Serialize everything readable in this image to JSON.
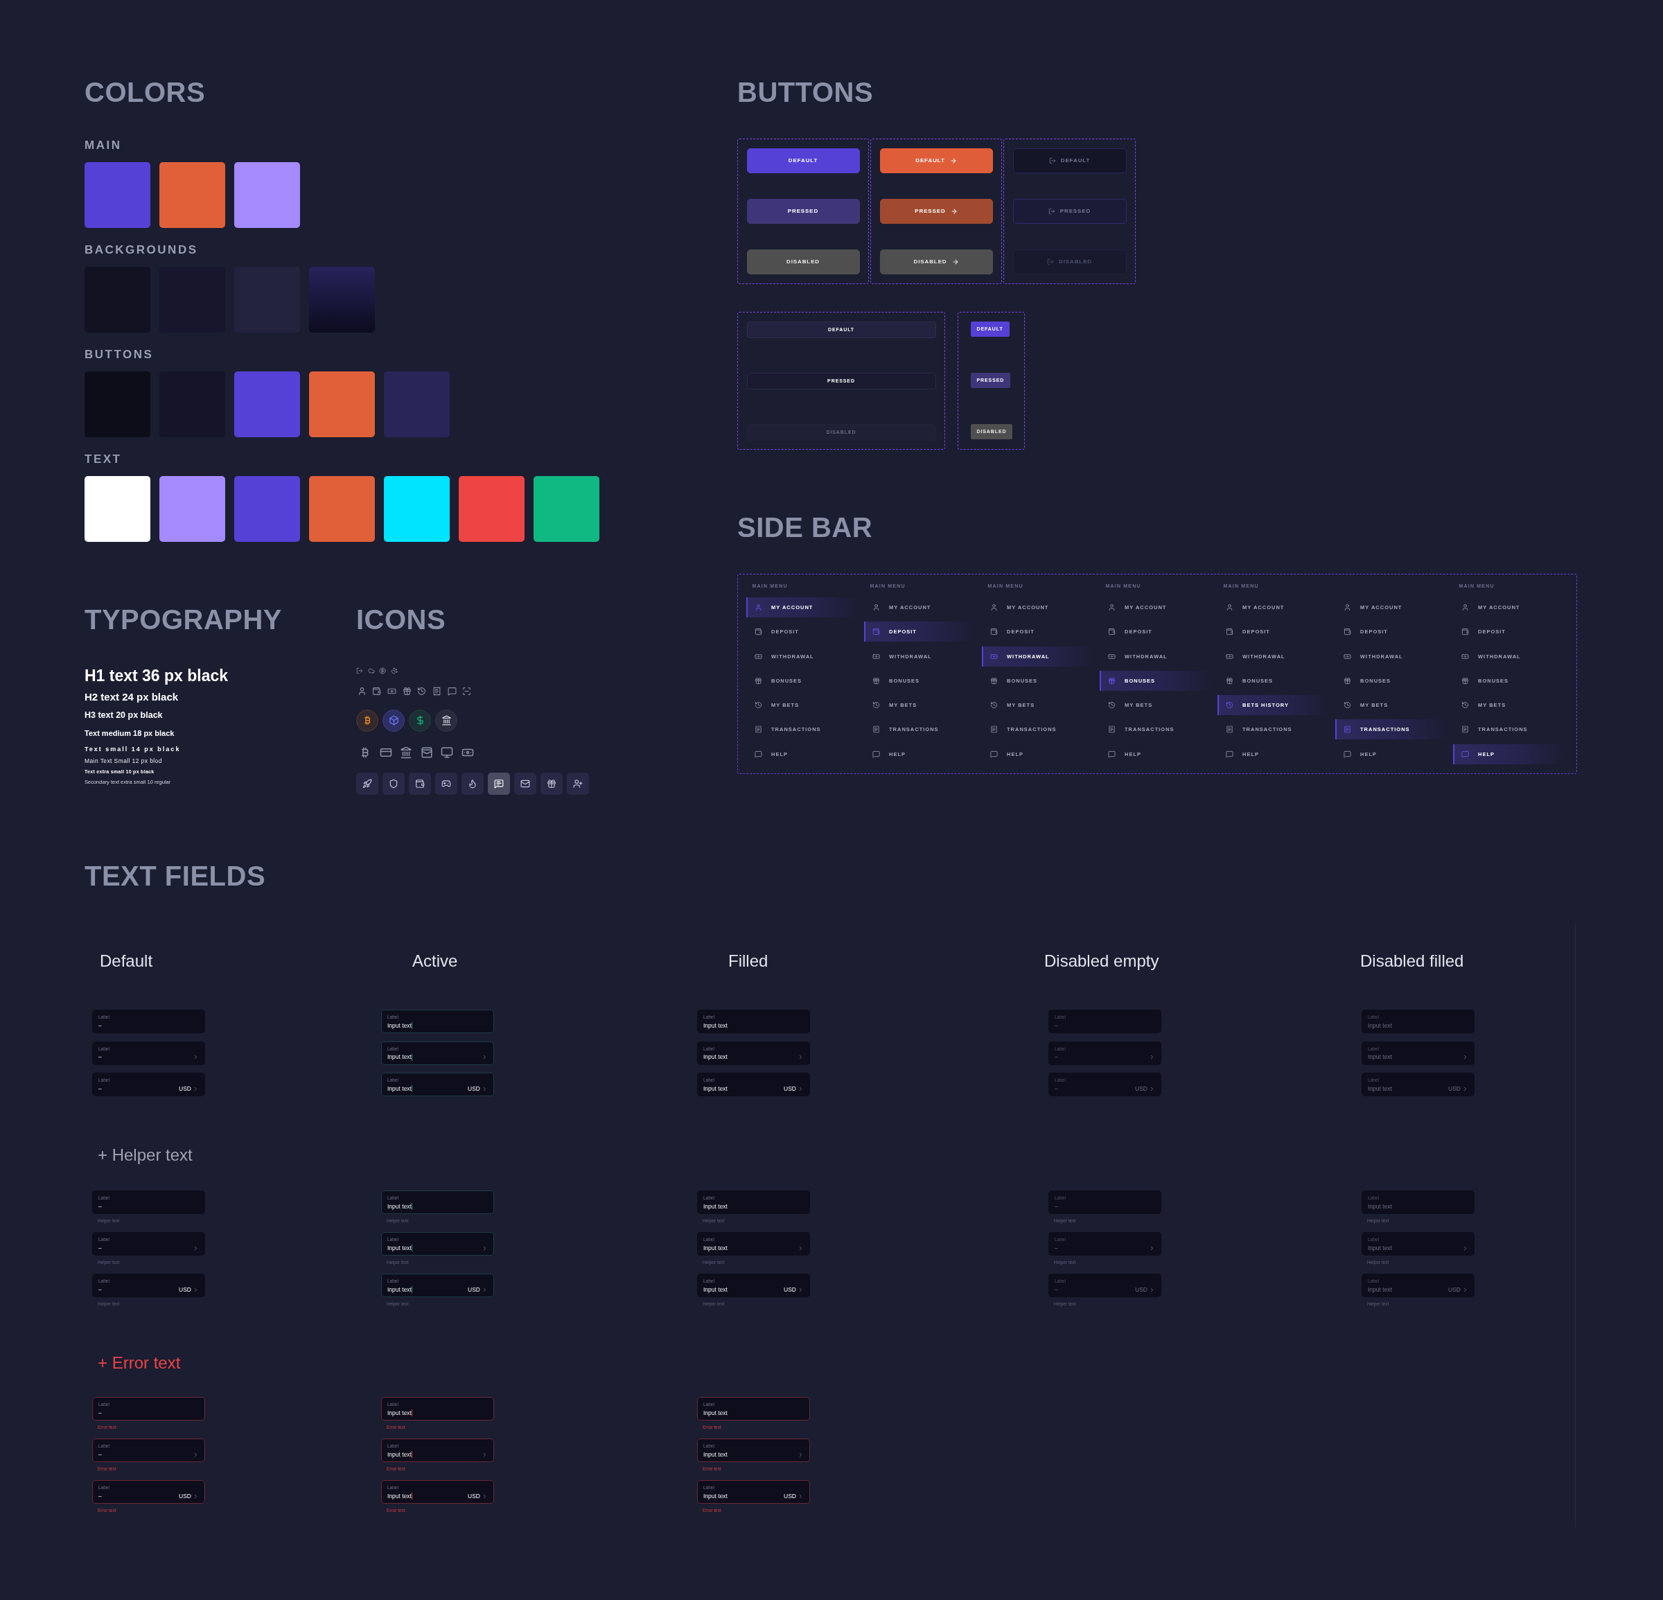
{
  "colors": {
    "title": "COLORS",
    "groups": [
      {
        "title": "MAIN",
        "swatches": [
          {
            "color": "#5641d6"
          },
          {
            "color": "#e0603a"
          },
          {
            "color": "#a48afc"
          }
        ]
      },
      {
        "title": "BACKGROUNDS",
        "swatches": [
          {
            "kind": "solid",
            "color": "#121222"
          },
          {
            "kind": "solid",
            "color": "#17162d"
          },
          {
            "kind": "solid",
            "color": "#23223f"
          },
          {
            "kind": "gradient",
            "color": "#26245a"
          }
        ]
      },
      {
        "title": "BUTTONS",
        "swatches": [
          {
            "color": "#0d0d19"
          },
          {
            "color": "#151429"
          },
          {
            "color": "#5641d6"
          },
          {
            "color": "#e0603a"
          },
          {
            "color": "#282659"
          }
        ]
      },
      {
        "title": "TEXT",
        "swatches": [
          {
            "color": "#ffffff"
          },
          {
            "color": "#a48afc"
          },
          {
            "color": "#5641d6"
          },
          {
            "color": "#e0603a"
          },
          {
            "color": "#00e5ff"
          },
          {
            "color": "#ef4444"
          },
          {
            "color": "#10b981"
          }
        ]
      }
    ]
  },
  "typography": {
    "title": "TYPOGRAPHY",
    "samples": [
      {
        "kind": "h1",
        "text": "H1 text 36 px black"
      },
      {
        "kind": "h2",
        "text": "H2 text 24 px black"
      },
      {
        "kind": "h3",
        "text": "H3 text 20 px black"
      },
      {
        "kind": "medium",
        "text": "Text medium 18 px black"
      },
      {
        "kind": "small",
        "text": "Text small 14 px black"
      },
      {
        "kind": "main_small",
        "text": "Main Text Small 12 px blod"
      },
      {
        "kind": "extra_small",
        "text": "Text extra small 10 px black"
      },
      {
        "kind": "secondary",
        "text": "Secondary text extra small 10 regular"
      }
    ]
  },
  "icons": {
    "title": "ICONS",
    "tiles": [
      {
        "selected": false
      },
      {
        "selected": false
      },
      {
        "selected": false
      },
      {
        "selected": false
      },
      {
        "selected": false
      },
      {
        "selected": true
      },
      {
        "selected": false
      },
      {
        "selected": false
      },
      {
        "selected": false
      }
    ]
  },
  "buttons": {
    "title": "BUTTONS",
    "rows": [
      {
        "groups": [
          {
            "kind": "primary",
            "buttons": [
              {
                "label": "DEFAULT",
                "pressed": false,
                "disabled": false
              },
              {
                "label": "PRESSED",
                "pressed": true,
                "disabled": false
              },
              {
                "label": "DISABLED",
                "pressed": false,
                "disabled": true
              }
            ]
          },
          {
            "kind": "accent",
            "buttons": [
              {
                "label": "DEFAULT",
                "pressed": false,
                "disabled": false
              },
              {
                "label": "PRESSED",
                "pressed": true,
                "disabled": false
              },
              {
                "label": "DISABLED",
                "pressed": false,
                "disabled": true
              }
            ]
          },
          {
            "kind": "outline",
            "buttons": [
              {
                "label": "DEFAULT",
                "pressed": false,
                "disabled": false
              },
              {
                "label": "PRESSED",
                "pressed": true,
                "disabled": false
              },
              {
                "label": "DISABLED",
                "pressed": false,
                "disabled": true
              }
            ]
          }
        ]
      },
      {
        "groups": [
          {
            "kind": "secondary",
            "buttons": [
              {
                "label": "DEFAULT",
                "pressed": false,
                "disabled": false
              },
              {
                "label": "PRESSED",
                "pressed": true,
                "disabled": false
              },
              {
                "label": "DISABLED",
                "pressed": false,
                "disabled": true
              }
            ]
          },
          {
            "kind": "small",
            "buttons": [
              {
                "label": "DEFAULT",
                "pressed": false,
                "disabled": false
              },
              {
                "label": "PRESSED",
                "pressed": true,
                "disabled": false
              },
              {
                "label": "DISABLED",
                "pressed": false,
                "disabled": true
              }
            ]
          }
        ]
      }
    ]
  },
  "sidebar": {
    "title": "SIDE BAR",
    "panels": [
      {
        "heading": "MAIN MENU",
        "items": [
          {
            "label": "MY ACCOUNT",
            "selected": true
          },
          {
            "label": "DEPOSIT",
            "selected": false
          },
          {
            "label": "WITHDRAWAL",
            "selected": false
          },
          {
            "label": "BONUSES",
            "selected": false
          },
          {
            "label": "MY BETS",
            "selected": false
          },
          {
            "label": "TRANSACTIONS",
            "selected": false
          },
          {
            "label": "HELP",
            "selected": false
          }
        ]
      },
      {
        "heading": "MAIN MENU",
        "items": [
          {
            "label": "MY ACCOUNT",
            "selected": false
          },
          {
            "label": "DEPOSIT",
            "selected": true
          },
          {
            "label": "WITHDRAWAL",
            "selected": false
          },
          {
            "label": "BONUSES",
            "selected": false
          },
          {
            "label": "MY BETS",
            "selected": false
          },
          {
            "label": "TRANSACTIONS",
            "selected": false
          },
          {
            "label": "HELP",
            "selected": false
          }
        ]
      },
      {
        "heading": "MAIN MENU",
        "items": [
          {
            "label": "MY ACCOUNT",
            "selected": false
          },
          {
            "label": "DEPOSIT",
            "selected": false
          },
          {
            "label": "WITHDRAWAL",
            "selected": true
          },
          {
            "label": "BONUSES",
            "selected": false
          },
          {
            "label": "MY BETS",
            "selected": false
          },
          {
            "label": "TRANSACTIONS",
            "selected": false
          },
          {
            "label": "HELP",
            "selected": false
          }
        ]
      },
      {
        "heading": "MAIN MENU",
        "items": [
          {
            "label": "MY ACCOUNT",
            "selected": false
          },
          {
            "label": "DEPOSIT",
            "selected": false
          },
          {
            "label": "WITHDRAWAL",
            "selected": false
          },
          {
            "label": "BONUSES",
            "selected": true
          },
          {
            "label": "MY BETS",
            "selected": false
          },
          {
            "label": "TRANSACTIONS",
            "selected": false
          },
          {
            "label": "HELP",
            "selected": false
          }
        ]
      },
      {
        "heading": "MAIN MENU",
        "items": [
          {
            "label": "MY ACCOUNT",
            "selected": false
          },
          {
            "label": "DEPOSIT",
            "selected": false
          },
          {
            "label": "WITHDRAWAL",
            "selected": false
          },
          {
            "label": "BONUSES",
            "selected": false
          },
          {
            "label": "BETS HISTORY",
            "selected": true
          },
          {
            "label": "TRANSACTIONS",
            "selected": false
          },
          {
            "label": "HELP",
            "selected": false
          }
        ]
      },
      {
        "items": [
          {
            "label": "MY ACCOUNT",
            "selected": false
          },
          {
            "label": "DEPOSIT",
            "selected": false
          },
          {
            "label": "WITHDRAWAL",
            "selected": false
          },
          {
            "label": "BONUSES",
            "selected": false
          },
          {
            "label": "MY BETS",
            "selected": false
          },
          {
            "label": "TRANSACTIONS",
            "selected": true
          },
          {
            "label": "HELP",
            "selected": false
          }
        ]
      },
      {
        "heading": "MAIN MENU",
        "items": [
          {
            "label": "MY ACCOUNT",
            "selected": false
          },
          {
            "label": "DEPOSIT",
            "selected": false
          },
          {
            "label": "WITHDRAWAL",
            "selected": false
          },
          {
            "label": "BONUSES",
            "selected": false
          },
          {
            "label": "MY BETS",
            "selected": false
          },
          {
            "label": "TRANSACTIONS",
            "selected": false
          },
          {
            "label": "HELP",
            "selected": true
          }
        ]
      }
    ]
  },
  "text_fields": {
    "title": "TEXT FIELDS",
    "columns": [
      {
        "heading": "Default",
        "focused": false,
        "disabled": false
      },
      {
        "heading": "Active",
        "focused": true,
        "disabled": false
      },
      {
        "heading": "Filled",
        "focused": false,
        "disabled": false
      },
      {
        "heading": "Disabled empty",
        "focused": false,
        "disabled": true
      },
      {
        "heading": "Disabled filled",
        "focused": false,
        "disabled": true
      }
    ],
    "groups": [
      {
        "kind": "plain",
        "columns": [
          {
            "fields": [
              {
                "label": "Label",
                "value": "–",
                "chevron": false
              },
              {
                "label": "Label",
                "value": "–",
                "chevron": true
              },
              {
                "label": "Label",
                "value": "–",
                "suffix": "USD",
                "chevron": true
              }
            ]
          },
          {
            "fields": [
              {
                "label": "Label",
                "value": "Input text",
                "chevron": false
              },
              {
                "label": "Label",
                "value": "Input text",
                "chevron": true
              },
              {
                "label": "Label",
                "value": "Input text",
                "suffix": "USD",
                "chevron": true
              }
            ]
          },
          {
            "fields": [
              {
                "label": "Label",
                "value": "Input text",
                "chevron": false
              },
              {
                "label": "Label",
                "value": "Input text",
                "chevron": true
              },
              {
                "label": "Label",
                "value": "Input text",
                "suffix": "USD",
                "chevron": true
              }
            ]
          },
          {
            "fields": [
              {
                "label": "Label",
                "value": "–",
                "chevron": false
              },
              {
                "label": "Label",
                "value": "–",
                "chevron": true
              },
              {
                "label": "Label",
                "value": "–",
                "suffix": "USD",
                "chevron": true
              }
            ]
          },
          {
            "fields": [
              {
                "label": "Label",
                "value": "Input text",
                "chevron": false
              },
              {
                "label": "Label",
                "value": "Input text",
                "chevron": true
              },
              {
                "label": "Label",
                "value": "Input text",
                "suffix": "USD",
                "chevron": true
              }
            ]
          }
        ]
      },
      {
        "kind": "helper",
        "title": "+ Helper text",
        "columns": [
          {
            "fields": [
              {
                "label": "Label",
                "value": "–",
                "chevron": false,
                "note": "Helper text"
              },
              {
                "label": "Label",
                "value": "–",
                "chevron": true,
                "note": "Helper text"
              },
              {
                "label": "Label",
                "value": "–",
                "suffix": "USD",
                "chevron": true,
                "note": "Helper text"
              }
            ]
          },
          {
            "fields": [
              {
                "label": "Label",
                "value": "Input text",
                "chevron": false,
                "note": "Helper text"
              },
              {
                "label": "Label",
                "value": "Input text",
                "chevron": true,
                "note": "Helper text"
              },
              {
                "label": "Label",
                "value": "Input text",
                "suffix": "USD",
                "chevron": true,
                "note": "Helper text"
              }
            ]
          },
          {
            "fields": [
              {
                "label": "Label",
                "value": "Input text",
                "chevron": false,
                "note": "Helper text"
              },
              {
                "label": "Label",
                "value": "Input text",
                "chevron": true,
                "note": "Helper text"
              },
              {
                "label": "Label",
                "value": "Input text",
                "suffix": "USD",
                "chevron": true,
                "note": "Helper text"
              }
            ]
          },
          {
            "fields": [
              {
                "label": "Label",
                "value": "–",
                "chevron": false,
                "note": "Helper text"
              },
              {
                "label": "Label",
                "value": "–",
                "chevron": true,
                "note": "Helper text"
              },
              {
                "label": "Label",
                "value": "–",
                "suffix": "USD",
                "chevron": true,
                "note": "Helper text"
              }
            ]
          },
          {
            "fields": [
              {
                "label": "Label",
                "value": "Input text",
                "chevron": false,
                "note": "Helper text"
              },
              {
                "label": "Label",
                "value": "Input text",
                "chevron": true,
                "note": "Helper text"
              },
              {
                "label": "Label",
                "value": "Input text",
                "suffix": "USD",
                "chevron": true,
                "note": "Helper text"
              }
            ]
          }
        ]
      },
      {
        "kind": "error",
        "title": "+ Error text",
        "columns": [
          {
            "fields": [
              {
                "label": "Label",
                "value": "–",
                "chevron": false,
                "note": "Error text"
              },
              {
                "label": "Label",
                "value": "–",
                "chevron": true,
                "note": "Error text"
              },
              {
                "label": "Label",
                "value": "–",
                "suffix": "USD",
                "chevron": true,
                "note": "Error text"
              }
            ]
          },
          {
            "fields": [
              {
                "label": "Label",
                "value": "Input text",
                "chevron": false,
                "note": "Error text"
              },
              {
                "label": "Label",
                "value": "Input text",
                "chevron": true,
                "note": "Error text"
              },
              {
                "label": "Label",
                "value": "Input text",
                "suffix": "USD",
                "chevron": true,
                "note": "Error text"
              }
            ]
          },
          {
            "fields": [
              {
                "label": "Label",
                "value": "Input text",
                "chevron": false,
                "note": "Error text"
              },
              {
                "label": "Label",
                "value": "Input text",
                "chevron": true,
                "note": "Error text"
              },
              {
                "label": "Label",
                "value": "Input text",
                "suffix": "USD",
                "chevron": true,
                "note": "Error text"
              }
            ]
          }
        ]
      }
    ]
  }
}
